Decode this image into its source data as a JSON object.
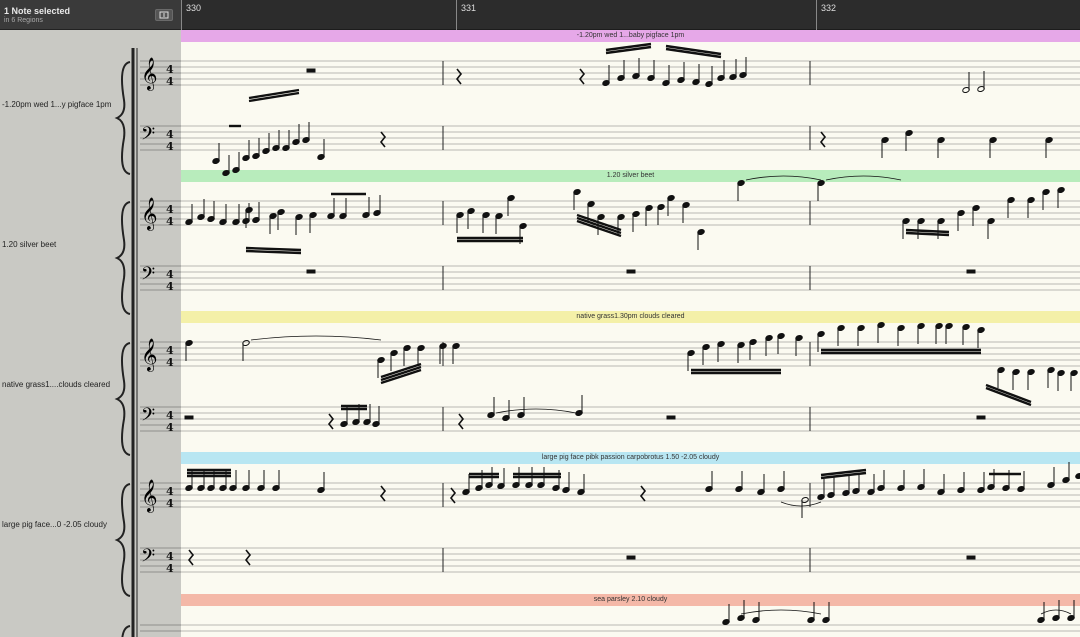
{
  "header": {
    "selection": "1 Note selected",
    "subtext": "in 6 Regions"
  },
  "ruler": {
    "bars": [
      "330",
      "331",
      "332"
    ]
  },
  "tracks": [
    {
      "label": "-1.20pm wed 1...y pigface 1pm",
      "region": "-1.20pm wed 1...baby pigface 1pm",
      "color": "#e6a8e8"
    },
    {
      "label": "1.20 silver beet",
      "region": "1.20 silver beet",
      "color": "#b8ecbc"
    },
    {
      "label": "native grass1....clouds cleared",
      "region": "native grass1.30pm clouds cleared",
      "color": "#f4f0a8"
    },
    {
      "label": "large pig face...0 -2.05 cloudy",
      "region": "large pig face pibk passion carpobrotus 1.50 -2.05 cloudy",
      "color": "#b8e6f2"
    },
    {
      "label": "",
      "region": "sea parsley 2.10 cloudy",
      "color": "#f4b8a8"
    }
  ],
  "icons": {
    "header_button": "capture-icon"
  }
}
